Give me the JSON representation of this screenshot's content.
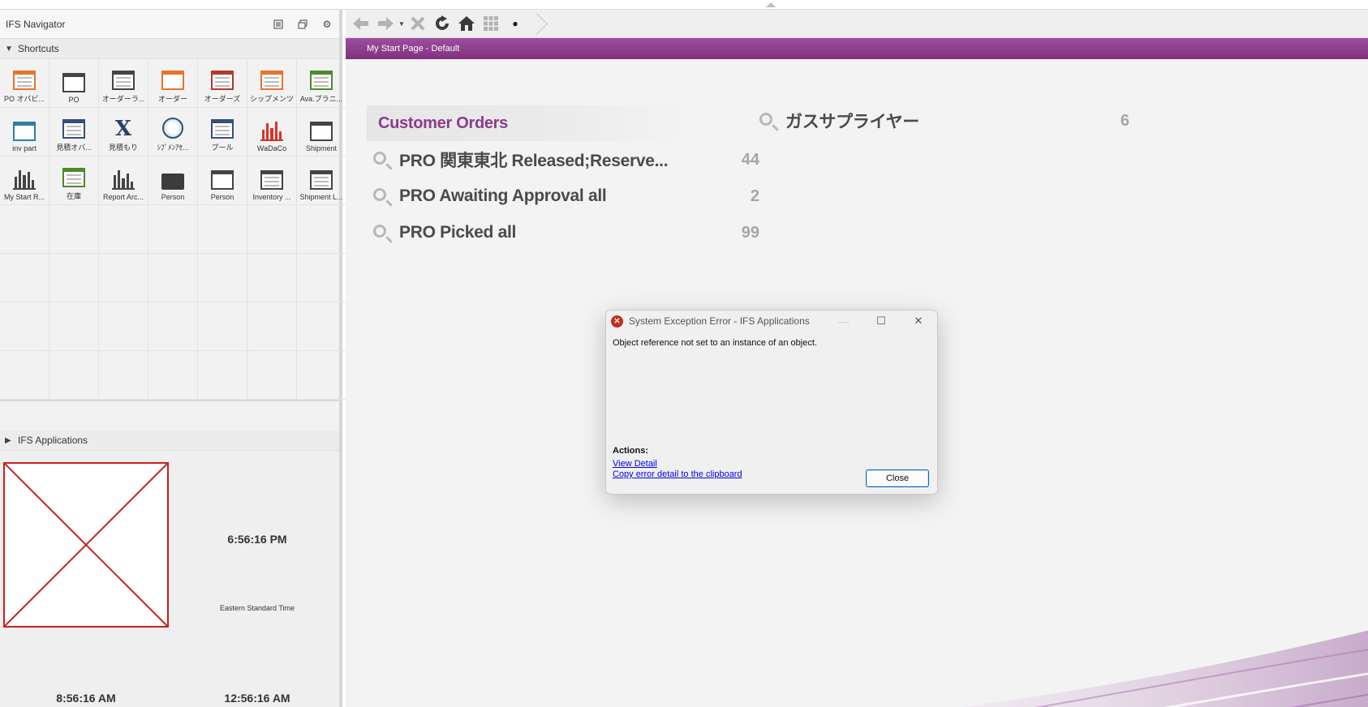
{
  "navigator": {
    "title": "IFS Navigator",
    "header_icons": [
      "list-settings-icon",
      "restore-window-icon",
      "gear-icon"
    ],
    "shortcuts_label": "Shortcuts",
    "shortcuts": [
      {
        "label": "PO オバビ...",
        "icon": "form-window-icon",
        "color": "#e8732a"
      },
      {
        "label": "PO",
        "icon": "window-icon",
        "color": "#444444"
      },
      {
        "label": "オーダーラ...",
        "icon": "form-window-icon",
        "color": "#444444"
      },
      {
        "label": "オーダー",
        "icon": "form-window-icon",
        "color": "#e8732a"
      },
      {
        "label": "オーダーズ",
        "icon": "form-window-icon",
        "color": "#b33a2a"
      },
      {
        "label": "シップメンツ",
        "icon": "form-window-icon",
        "color": "#e8732a"
      },
      {
        "label": "Ava.プラニ...",
        "icon": "form-window-icon",
        "color": "#4c8a2c"
      },
      {
        "label": "inv part",
        "icon": "form-window-icon",
        "color": "#2f7ea0"
      },
      {
        "label": "見積オバ...",
        "icon": "form-window-icon",
        "color": "#34507a"
      },
      {
        "label": "見積もり",
        "icon": "excel-export-icon",
        "color": "#2b3f66"
      },
      {
        "label": "ｼﾌﾟﾒﾝｱｾ...",
        "icon": "globe-icon",
        "color": "#34507a"
      },
      {
        "label": "プール",
        "icon": "form-window-icon",
        "color": "#34507a"
      },
      {
        "label": "WaDaCo",
        "icon": "bar-chart-icon",
        "color": "#d9342b"
      },
      {
        "label": "Shipment",
        "icon": "window-icon",
        "color": "#444444"
      },
      {
        "label": "My Start R...",
        "icon": "bar-chart-icon",
        "color": "#444444"
      },
      {
        "label": "在庫",
        "icon": "form-window-icon",
        "color": "#4c8a2c"
      },
      {
        "label": "Report Arc...",
        "icon": "bar-chart-icon",
        "color": "#444444"
      },
      {
        "label": "Person",
        "icon": "folder-icon",
        "color": "#3c3c3c"
      },
      {
        "label": "Person",
        "icon": "window-icon",
        "color": "#444444"
      },
      {
        "label": "Inventory ...",
        "icon": "form-window-icon",
        "color": "#444444"
      },
      {
        "label": "Shipment L...",
        "icon": "form-window-icon",
        "color": "#444444"
      }
    ],
    "apps_label": "IFS Applications",
    "clocks": {
      "main_time": "6:56:16 PM",
      "main_zone": "Eastern Standard Time",
      "time_a": "8:56:16 AM",
      "time_b": "12:56:16 AM"
    }
  },
  "toolbar": {
    "buttons": [
      "back-arrow-icon",
      "forward-arrow-icon",
      "history-dropdown-icon",
      "stop-icon",
      "refresh-icon",
      "home-icon",
      "grid-icon",
      "dot-icon"
    ]
  },
  "page": {
    "tab_title": "My Start Page - Default",
    "accent": "#8a3b8c"
  },
  "customer_orders": {
    "title": "Customer Orders",
    "queries": [
      {
        "label": "PRO 関東東北 Released;Reserve...",
        "count": "44"
      },
      {
        "label": "PRO Awaiting Approval all",
        "count": "2"
      },
      {
        "label": "PRO Picked all",
        "count": "99"
      }
    ]
  },
  "supplier_query": {
    "label": "ガスサプライヤー",
    "count": "6"
  },
  "dialog": {
    "title": "System Exception Error - IFS Applications",
    "message": "Object reference not set to an instance of an object.",
    "actions_label": "Actions:",
    "link_detail": "View Detail",
    "link_copy": "Copy error detail to the clipboard",
    "close_label": "Close"
  }
}
